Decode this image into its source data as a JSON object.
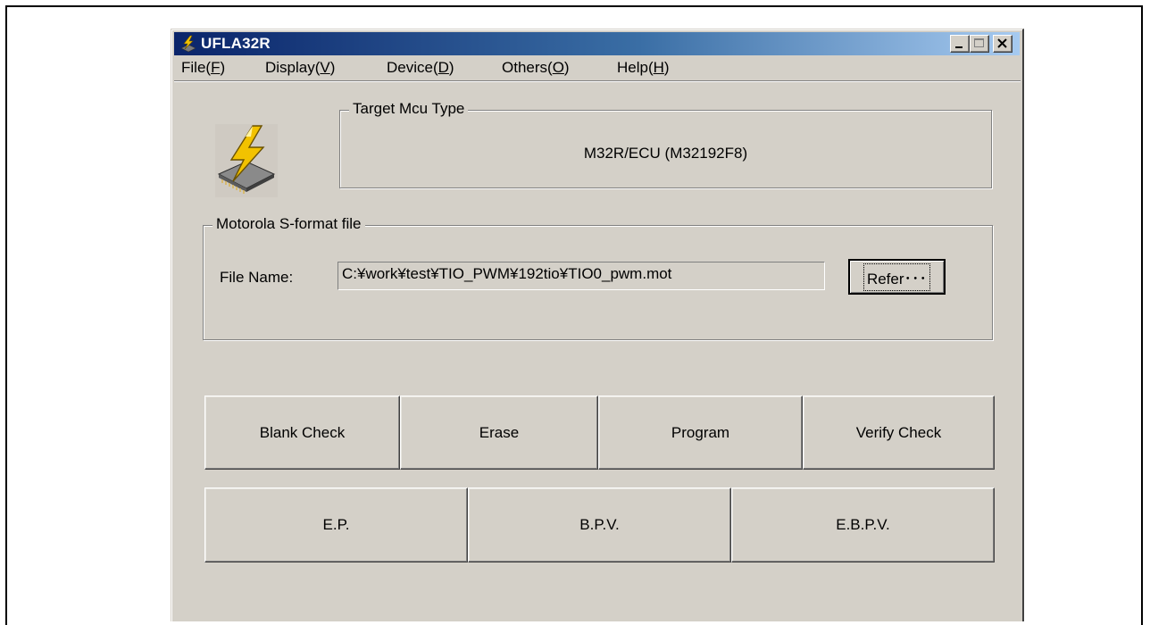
{
  "window": {
    "title": "UFLA32R"
  },
  "menu": [
    {
      "label": "File(",
      "accel": "F",
      "end": ")"
    },
    {
      "label": "Display(",
      "accel": "V",
      "end": ")"
    },
    {
      "label": "Device(",
      "accel": "D",
      "end": ")"
    },
    {
      "label": "Others(",
      "accel": "O",
      "end": ")"
    },
    {
      "label": "Help(",
      "accel": "H",
      "end": ")"
    }
  ],
  "target": {
    "group_title": "Target Mcu Type",
    "value": "M32R/ECU (M32192F8)"
  },
  "sfile": {
    "group_title": "Motorola S-format file",
    "file_label": "File Name:",
    "file_value": "C:¥work¥test¥TIO_PWM¥192tio¥TIO0_pwm.mot",
    "refer_button": "Refer･･･"
  },
  "actions_row1": [
    "Blank Check",
    "Erase",
    "Program",
    "Verify Check"
  ],
  "actions_row2": [
    "E.P.",
    "B.P.V.",
    "E.B.P.V."
  ],
  "icons": {
    "app": "lightning-chip-icon",
    "minimize": "minimize-icon",
    "maximize": "maximize-icon",
    "close": "close-icon"
  },
  "colors": {
    "titlebar_start": "#0a246a",
    "titlebar_end": "#a6caf0",
    "face": "#d4d0c8",
    "bolt": "#f2c200"
  }
}
